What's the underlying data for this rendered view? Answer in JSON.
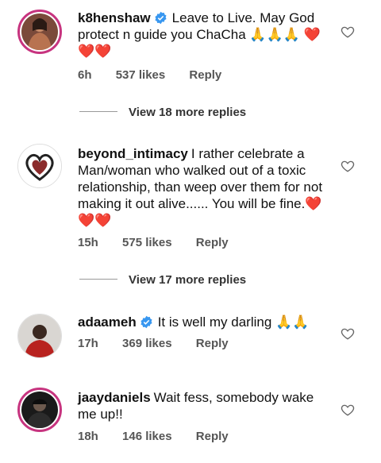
{
  "comments": [
    {
      "username": "k8henshaw",
      "verified": true,
      "text": "Leave to Live. May God protect n guide you ChaCha 🙏🙏🙏 ❤️❤️❤️",
      "time": "6h",
      "likes": "537 likes",
      "reply": "Reply",
      "view_more": "View 18 more replies"
    },
    {
      "username": "beyond_intimacy",
      "verified": false,
      "text": "I rather celebrate a Man/woman who walked out of a toxic relationship, than weep over them for not making it out alive...... You will be fine.❤️❤️❤️",
      "time": "15h",
      "likes": "575 likes",
      "reply": "Reply",
      "view_more": "View 17 more replies"
    },
    {
      "username": "adaameh",
      "verified": true,
      "text": "It is well my darling 🙏🙏",
      "time": "17h",
      "likes": "369 likes",
      "reply": "Reply"
    },
    {
      "username": "jaaydaniels",
      "verified": false,
      "text": "Wait fess, somebody wake me up!!",
      "time": "18h",
      "likes": "146 likes",
      "reply": "Reply"
    }
  ],
  "colors": {
    "verified": "#3897f0",
    "story_ring": "#c7347f",
    "meta_text": "#555555"
  },
  "icons": [
    "verified-badge-icon",
    "heart-outline-icon"
  ]
}
